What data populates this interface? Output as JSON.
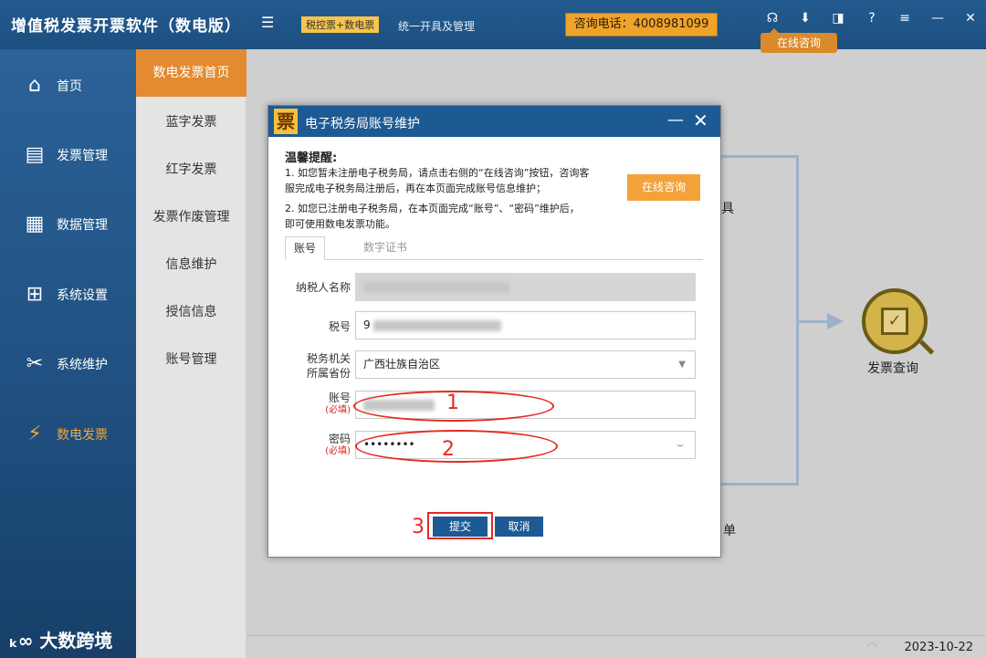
{
  "app": {
    "title": "增值税发票开票软件（数电版）",
    "tag": "税控票+数电票",
    "subtitle": "统一开具及管理",
    "hotline": "咨询电话：4008981099",
    "online_tip": "在线咨询"
  },
  "sidebar": {
    "items": [
      {
        "label": "首页",
        "icon": "home-icon"
      },
      {
        "label": "发票管理",
        "icon": "printer-icon"
      },
      {
        "label": "数据管理",
        "icon": "database-icon"
      },
      {
        "label": "系统设置",
        "icon": "sliders-icon"
      },
      {
        "label": "系统维护",
        "icon": "tools-icon"
      },
      {
        "label": "数电发票",
        "icon": "invoice-bolt-icon",
        "active": true
      }
    ],
    "brand": "大数跨境"
  },
  "subnav": {
    "items": [
      "数电发票首页",
      "蓝字发票",
      "红字发票",
      "发票作废管理",
      "信息维护",
      "授信信息",
      "账号管理"
    ]
  },
  "background": {
    "query_label": "发票查询",
    "partial_label_1": "具",
    "partial_label_2": "单"
  },
  "dialog": {
    "logo": "票",
    "title": "电子税务局账号维护",
    "tip_title": "温馨提醒:",
    "tip_lines": [
      "1. 如您暂未注册电子税务局，请点击右侧的“在线咨询”按钮，咨询客",
      "服完成电子税务局注册后，再在本页面完成账号信息维护；",
      "2. 如您已注册电子税务局，在本页面完成“账号”、“密码”维护后，",
      "即可使用数电发票功能。"
    ],
    "online_button": "在线咨询",
    "tabs": [
      "账号",
      "数字证书"
    ],
    "form": {
      "taxpayer_label": "纳税人名称",
      "tax_id_label": "税号",
      "tax_id_value": "9",
      "province_label_1": "税务机关",
      "province_label_2": "所属省份",
      "province_value": "广西壮族自治区",
      "account_label": "账号",
      "password_label": "密码",
      "required_note": "(必填)",
      "password_value": "••••••••"
    },
    "annotations": [
      "1",
      "2",
      "3"
    ],
    "submit": "提交",
    "cancel": "取消"
  },
  "status": {
    "date": "2023-10-22"
  }
}
